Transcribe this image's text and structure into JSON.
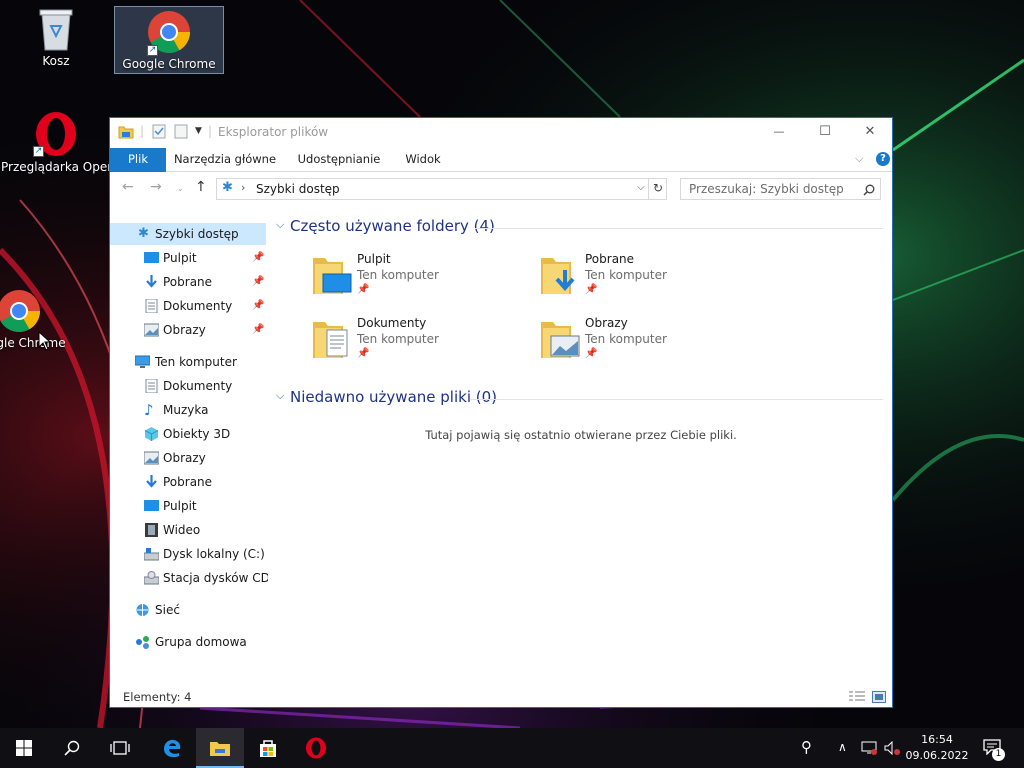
{
  "desktop": {
    "icons": [
      {
        "label": "Kosz",
        "icon": "recycle-bin-icon"
      },
      {
        "label": "Google Chrome",
        "icon": "chrome-icon"
      },
      {
        "label": "Przeglądarka Opera",
        "icon": "opera-icon"
      },
      {
        "label": "Google Chrome",
        "icon": "chrome-icon"
      }
    ]
  },
  "window": {
    "title": "Eksplorator plików",
    "tabs": [
      "Plik",
      "Narzędzia główne",
      "Udostępnianie",
      "Widok"
    ],
    "address": "Szybki dostęp",
    "search_placeholder": "Przeszukaj: Szybki dostęp",
    "status": "Elementy: 4",
    "buttons": {
      "minimize": "—",
      "maximize": "☐",
      "close": "✕",
      "help": "?"
    }
  },
  "nav": {
    "quick_access": "Szybki dostęp",
    "quick_items": [
      "Pulpit",
      "Pobrane",
      "Dokumenty",
      "Obrazy"
    ],
    "this_pc": "Ten komputer",
    "pc_items": [
      "Dokumenty",
      "Muzyka",
      "Obiekty 3D",
      "Obrazy",
      "Pobrane",
      "Pulpit",
      "Wideo",
      "Dysk lokalny (C:)",
      "Stacja dysków CD (D:)"
    ],
    "network": "Sieć",
    "homegroup": "Grupa domowa"
  },
  "content": {
    "frequent_header": "Często używane foldery (4)",
    "folders": [
      {
        "name": "Pulpit",
        "location": "Ten komputer",
        "icon": "desktop-folder-icon"
      },
      {
        "name": "Pobrane",
        "location": "Ten komputer",
        "icon": "downloads-folder-icon"
      },
      {
        "name": "Dokumenty",
        "location": "Ten komputer",
        "icon": "documents-folder-icon"
      },
      {
        "name": "Obrazy",
        "location": "Ten komputer",
        "icon": "pictures-folder-icon"
      }
    ],
    "recent_header": "Niedawno używane pliki (0)",
    "empty_message": "Tutaj pojawią się ostatnio otwierane przez Ciebie pliki."
  },
  "taskbar": {
    "time": "16:54",
    "date": "09.06.2022",
    "notification_count": "1"
  },
  "colors": {
    "accent": "#1979ca",
    "header_blue": "#1e3287",
    "folder_yellow": "#f7d774",
    "selection": "#cce8ff"
  }
}
